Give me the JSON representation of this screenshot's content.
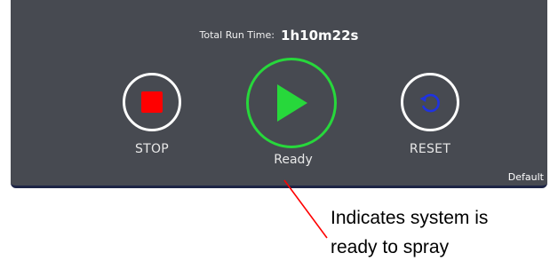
{
  "header": {
    "runtime_label": "Total Run Time:",
    "runtime_value": "1h10m22s"
  },
  "controls": {
    "stop": {
      "label": "STOP",
      "icon": "stop-square-icon",
      "color": "#ff0000"
    },
    "start": {
      "icon": "play-triangle-icon",
      "color": "#27d83b"
    },
    "reset": {
      "label": "RESET",
      "icon": "rotate-arrow-icon",
      "color": "#1f33e0"
    }
  },
  "status": {
    "text": "Ready"
  },
  "mode": {
    "text": "Default"
  },
  "annotation": {
    "line1": "Indicates system is",
    "line2": "ready to spray",
    "line_color": "#ff0000"
  },
  "colors": {
    "panel": "#474a51",
    "panel_border": "#1d2445"
  }
}
